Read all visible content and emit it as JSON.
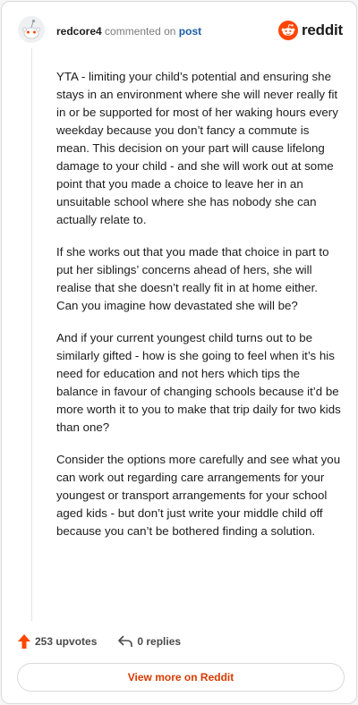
{
  "comment": {
    "username": "redcore4",
    "action_text": "commented on",
    "post_link": "post",
    "paragraphs": [
      "YTA - limiting your child’s potential and ensuring she stays in an environment where she will never really fit in or be supported for most of her waking hours every weekday because you don’t fancy a commute is mean. This decision on your part will cause lifelong damage to your child - and she will work out at some point that you made a choice to leave her in an unsuitable school where she has nobody she can actually relate to.",
      "If she works out that you made that choice in part to put her siblings’ concerns ahead of hers, she will realise that she doesn’t really fit in at home either. Can you imagine how devastated she will be?",
      "And if your current youngest child turns out to be similarly gifted - how is she going to feel when it’s his need for education and not hers which tips the balance in favour of changing schools because it’d be more worth it to you to make that trip daily for two kids than one?",
      "Consider the options more carefully and see what you can work out regarding care arrangements for your youngest or transport arrangements for your school aged kids - but don’t just write your middle child off because you can’t be bothered finding a solution."
    ],
    "upvotes_label": "253 upvotes",
    "replies_label": "0 replies"
  },
  "brand": {
    "wordmark": "reddit",
    "color": "#ff4500"
  },
  "footer": {
    "view_more_label": "View more on Reddit"
  },
  "icons": {
    "avatar": "snoo-avatar-icon",
    "logo": "reddit-logo-icon",
    "upvote": "upvote-arrow-icon",
    "reply": "reply-arrow-icon"
  }
}
